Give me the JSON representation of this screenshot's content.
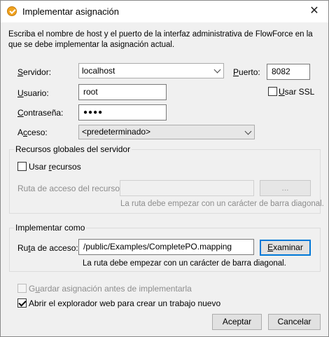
{
  "window": {
    "title": "Implementar asignación",
    "close_glyph": "✕"
  },
  "description": "Escriba el nombre de host y el puerto de la interfaz administrativa de FlowForce en la que se debe implementar la asignación actual.",
  "server": {
    "label_mnemonic": "S",
    "label_rest": "ervidor:",
    "value": "localhost"
  },
  "port": {
    "label_mnemonic": "P",
    "label_rest": "uerto:",
    "value": "8082"
  },
  "ssl": {
    "label_mnemonic": "U",
    "label_rest": "sar SSL",
    "checked": false
  },
  "user": {
    "label_mnemonic": "U",
    "label_rest": "suario:",
    "value": "root"
  },
  "password": {
    "label_mnemonic": "C",
    "label_rest": "ontraseña:",
    "value": "●●●●"
  },
  "access": {
    "label_pre": "A",
    "label_mnemonic": "c",
    "label_rest": "ceso:",
    "value": "<predeterminado>"
  },
  "global_resources": {
    "title": "Recursos globales del servidor",
    "use_label_pre": "Usar ",
    "use_label_mnemonic": "r",
    "use_label_rest": "ecursos",
    "use_checked": false,
    "path_label": "Ruta de acceso del recurso:",
    "path_value": "",
    "browse_label": "...",
    "hint": "La ruta debe empezar con un carácter de barra diagonal."
  },
  "deploy_as": {
    "title": "Implementar como",
    "path_label_pre": "Ru",
    "path_label_mnemonic": "t",
    "path_label_rest": "a de acceso:",
    "path_value": "/public/Examples/CompletePO.mapping",
    "browse_label_mnemonic": "E",
    "browse_label_rest": "xaminar",
    "hint": "La ruta debe empezar con un carácter de barra diagonal."
  },
  "save_before": {
    "label_pre": "G",
    "label_mnemonic": "u",
    "label_rest": "ardar asignación antes de implementarla",
    "checked": false,
    "enabled": false
  },
  "open_browser": {
    "label": "Abrir el explorador web para crear un trabajo nuevo",
    "checked": true
  },
  "buttons": {
    "ok": "Aceptar",
    "cancel": "Cancelar"
  }
}
